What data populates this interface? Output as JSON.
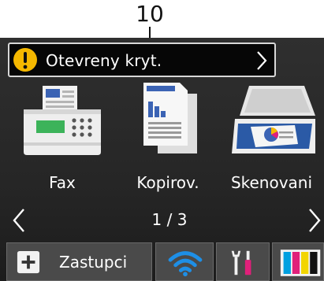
{
  "callout": {
    "number": "10"
  },
  "status": {
    "message": "Otevreny kryt.",
    "icon": "warning-icon"
  },
  "tiles": [
    {
      "label": "Fax",
      "icon": "fax-icon"
    },
    {
      "label": "Kopirov.",
      "icon": "copy-icon"
    },
    {
      "label": "Skenovani",
      "icon": "scanner-icon"
    }
  ],
  "pager": {
    "indicator": "1 / 3"
  },
  "bottom_bar": {
    "shortcuts_label": "Zastupci",
    "wifi_icon": "wifi-icon",
    "settings_icon": "tools-icon",
    "ink_icon": "ink-cartridges-icon"
  },
  "colors": {
    "warning": "#f5b800",
    "wifi": "#1e8fe6",
    "ink_cyan": "#00a0e0",
    "ink_magenta": "#e0207a",
    "ink_yellow": "#f2d500",
    "ink_black": "#111111"
  }
}
